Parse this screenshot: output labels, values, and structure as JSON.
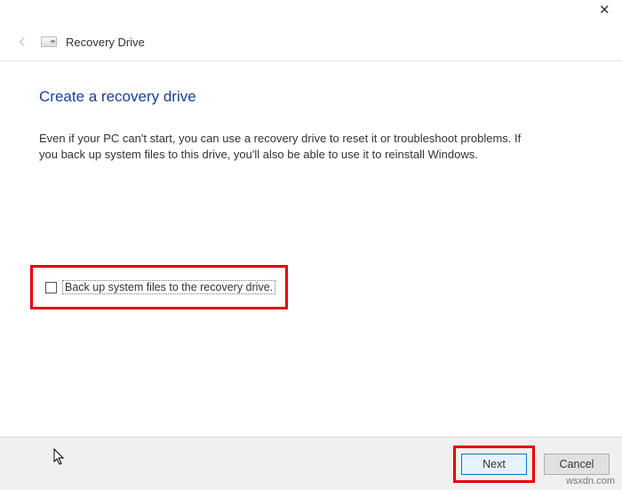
{
  "window": {
    "title": "Recovery Drive"
  },
  "page": {
    "heading": "Create a recovery drive",
    "description": "Even if your PC can't start, you can use a recovery drive to reset it or troubleshoot problems. If you back up system files to this drive, you'll also be able to use it to reinstall Windows."
  },
  "checkbox": {
    "label": "Back up system files to the recovery drive.",
    "checked": false
  },
  "buttons": {
    "next": "Next",
    "cancel": "Cancel"
  },
  "watermark": "wsxdn.com"
}
